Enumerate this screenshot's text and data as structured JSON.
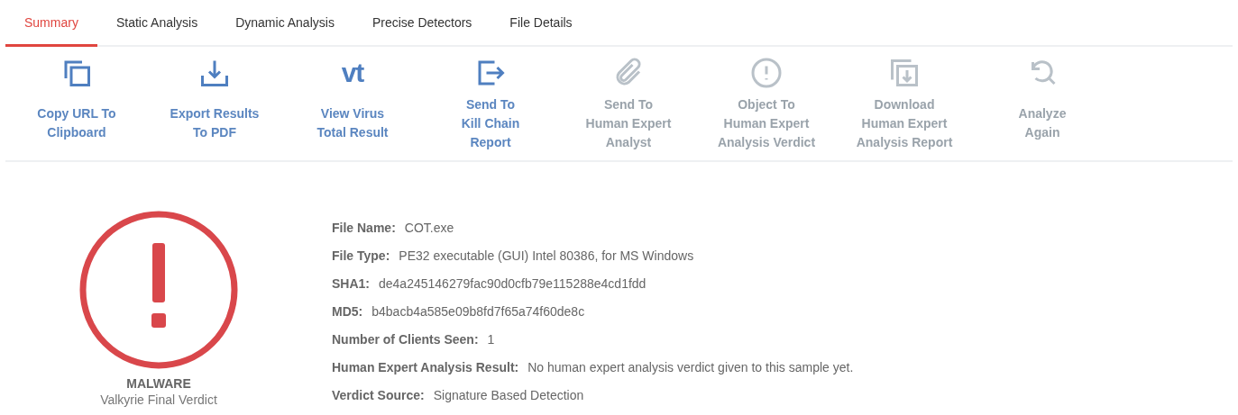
{
  "tabs": [
    {
      "label": "Summary",
      "selected": true
    },
    {
      "label": "Static Analysis",
      "selected": false
    },
    {
      "label": "Dynamic Analysis",
      "selected": false
    },
    {
      "label": "Precise Detectors",
      "selected": false
    },
    {
      "label": "File Details",
      "selected": false
    }
  ],
  "actions": [
    {
      "kind": "copy",
      "label": "Copy URL To\nClipboard",
      "disabled": false
    },
    {
      "kind": "export",
      "label": "Export Results\nTo PDF",
      "disabled": false
    },
    {
      "kind": "logo",
      "logo_text": "vt",
      "label": "View Virus\nTotal Result",
      "disabled": false
    },
    {
      "kind": "send",
      "label": "Send To\nKill Chain\nReport",
      "disabled": false
    },
    {
      "kind": "paperclip",
      "label": "Send To\nHuman Expert\nAnalyst",
      "disabled": true
    },
    {
      "kind": "alert",
      "label": "Object To\nHuman Expert\nAnalysis Verdict",
      "disabled": true
    },
    {
      "kind": "download",
      "label": "Download\nHuman Expert\nAnalysis Report",
      "disabled": true
    },
    {
      "kind": "reanalyze",
      "label": "Analyze\nAgain",
      "disabled": true
    }
  ],
  "verdict": {
    "label": "MALWARE",
    "caption": "Valkyrie Final Verdict"
  },
  "details": [
    {
      "label": "File Name:",
      "value": "COT.exe"
    },
    {
      "label": "File Type:",
      "value": "PE32 executable (GUI) Intel 80386, for MS Windows"
    },
    {
      "label": "SHA1:",
      "value": "de4a245146279fac90d0cfb79e115288e4cd1fdd"
    },
    {
      "label": "MD5:",
      "value": "b4bacb4a585e09b8fd7f65a74f60de8c"
    },
    {
      "label": "Number of Clients Seen:",
      "value": "1"
    },
    {
      "label": "Human Expert Analysis Result:",
      "value": "No human expert analysis verdict given to this sample yet."
    },
    {
      "label": "Verdict Source:",
      "value": "Signature Based Detection"
    }
  ]
}
